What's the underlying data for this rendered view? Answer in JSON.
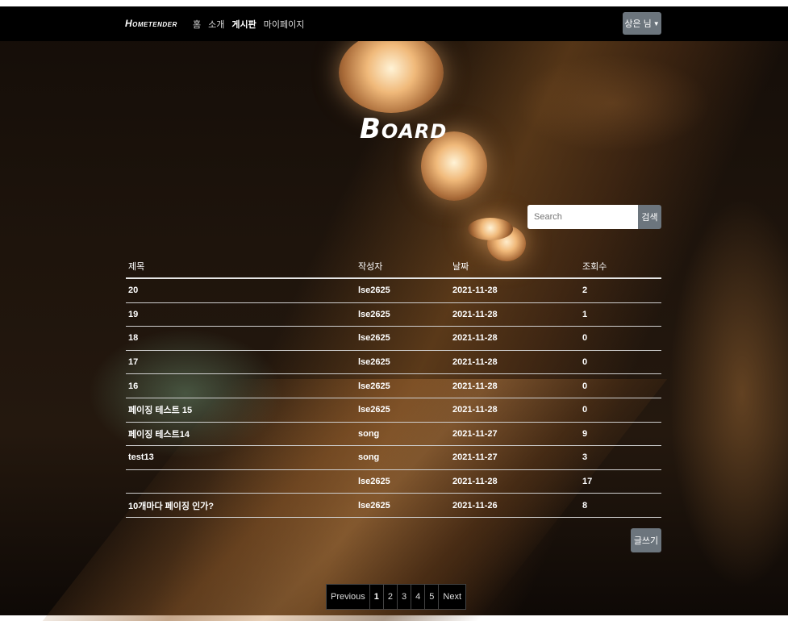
{
  "navbar": {
    "brand": "Hometender",
    "links": [
      "홈",
      "소개",
      "게시판",
      "마이페이지"
    ],
    "active_link": "게시판",
    "user_menu_label": "상은 님"
  },
  "page_title": "Board",
  "search": {
    "placeholder": "Search",
    "button_label": "검색"
  },
  "table": {
    "headers": [
      "제목",
      "작성자",
      "날짜",
      "조회수"
    ],
    "rows": [
      [
        "20",
        "lse2625",
        "2021-11-28",
        "2"
      ],
      [
        "19",
        "lse2625",
        "2021-11-28",
        "1"
      ],
      [
        "18",
        "lse2625",
        "2021-11-28",
        "0"
      ],
      [
        "17",
        "lse2625",
        "2021-11-28",
        "0"
      ],
      [
        "16",
        "lse2625",
        "2021-11-28",
        "0"
      ],
      [
        "페이징 테스트 15",
        "lse2625",
        "2021-11-28",
        "0"
      ],
      [
        "페이징 테스트14",
        "song",
        "2021-11-27",
        "9"
      ],
      [
        "test13",
        "song",
        "2021-11-27",
        "3"
      ],
      [
        "",
        "lse2625",
        "2021-11-28",
        "17"
      ],
      [
        "10개마다 페이징 인가?",
        "lse2625",
        "2021-11-26",
        "8"
      ]
    ]
  },
  "write_button_label": "글쓰기",
  "pagination": {
    "previous": "Previous",
    "pages": [
      "1",
      "2",
      "3",
      "4",
      "5"
    ],
    "current": "1",
    "next": "Next"
  }
}
